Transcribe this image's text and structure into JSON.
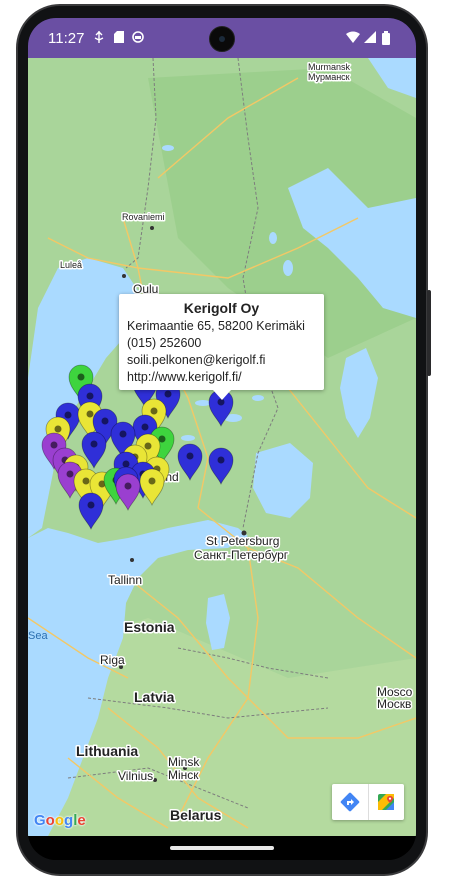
{
  "status_bar": {
    "time": "11:27",
    "left_icons": [
      "usb-debug-icon",
      "sd-card-icon",
      "app-notification-icon"
    ],
    "right_icons": [
      "wifi-icon",
      "cellular-signal-icon",
      "battery-icon"
    ],
    "color": "#6a4fa3"
  },
  "map": {
    "land_color": "#a9d59a",
    "water_color": "#aadaff",
    "labels": {
      "murmansk": "Murmansk",
      "murmansk_ru": "Мурманск",
      "rovaniemi": "Rovaniemi",
      "lulea": "Luleå",
      "oulu": "Oulu",
      "finland": "land",
      "st_petersburg": "St Petersburg",
      "st_petersburg_ru": "Санкт-Петербург",
      "tallinn": "Tallinn",
      "estonia": "Estonia",
      "sea": "Sea",
      "riga": "Riga",
      "latvia": "Latvia",
      "lithuania": "Lithuania",
      "vilnius": "Vilnius",
      "vilnius_lt": "Vilnius",
      "minsk": "Minsk",
      "minsk_ru": "Мінск",
      "belarus": "Belarus",
      "moscow": "Mosco",
      "moscow_ru": "Москв"
    },
    "marker_colors": {
      "blue": "#2f2fd8",
      "yellow": "#e9e536",
      "green": "#3ed43e",
      "purple": "#9a3fd0"
    }
  },
  "info_window": {
    "title": "Kerigolf Oy",
    "address": "Kerimaantie 65, 58200 Kerimäki",
    "phone": "(015) 252600",
    "email": "soili.pelkonen@kerigolf.fi",
    "website": "http://www.kerigolf.fi/"
  },
  "toolbar": {
    "directions_icon": "directions-icon",
    "open_maps_icon": "google-maps-icon"
  },
  "google_logo": [
    "G",
    "o",
    "o",
    "g",
    "l",
    "e"
  ]
}
